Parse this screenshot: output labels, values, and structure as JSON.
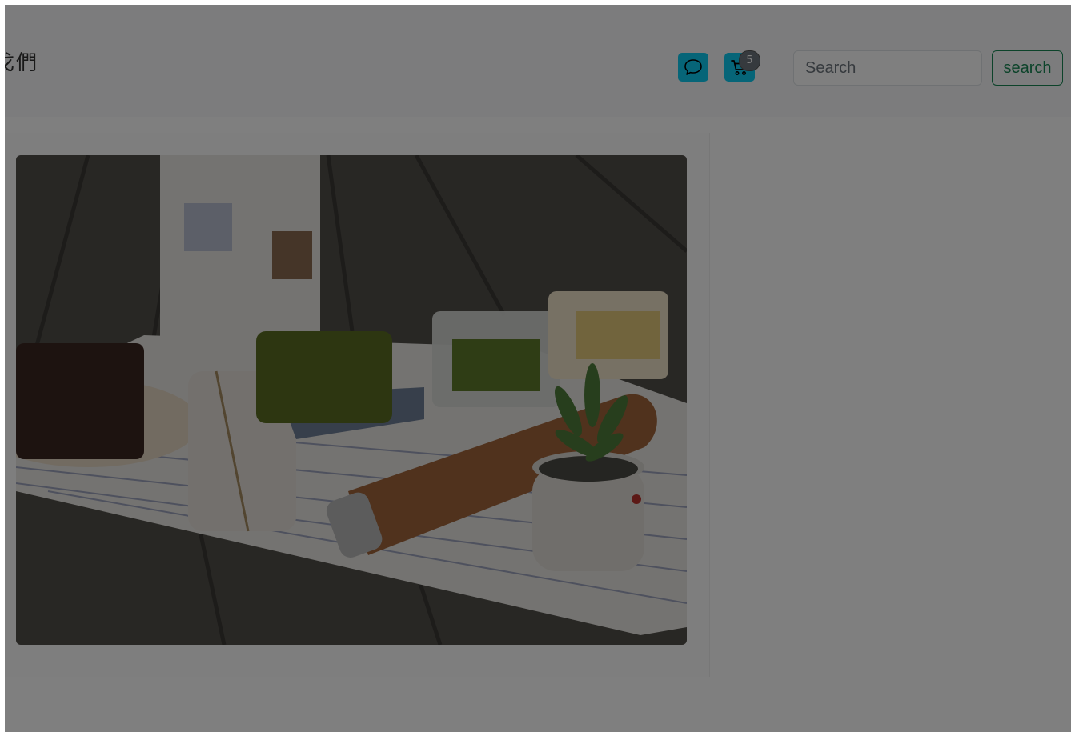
{
  "navbar": {
    "brand": "戈們",
    "cart_count": "5",
    "search_placeholder": "Search",
    "search_button": "search"
  },
  "icons": {
    "chat": "chat-bubble-icon",
    "cart": "cart-icon"
  },
  "colors": {
    "accent": "#0dcaf0",
    "search_outline": "#198754",
    "badge": "#6c757d",
    "overlay": "rgba(0,0,0,0.5)"
  },
  "photo": {
    "subject": "product-photo"
  }
}
